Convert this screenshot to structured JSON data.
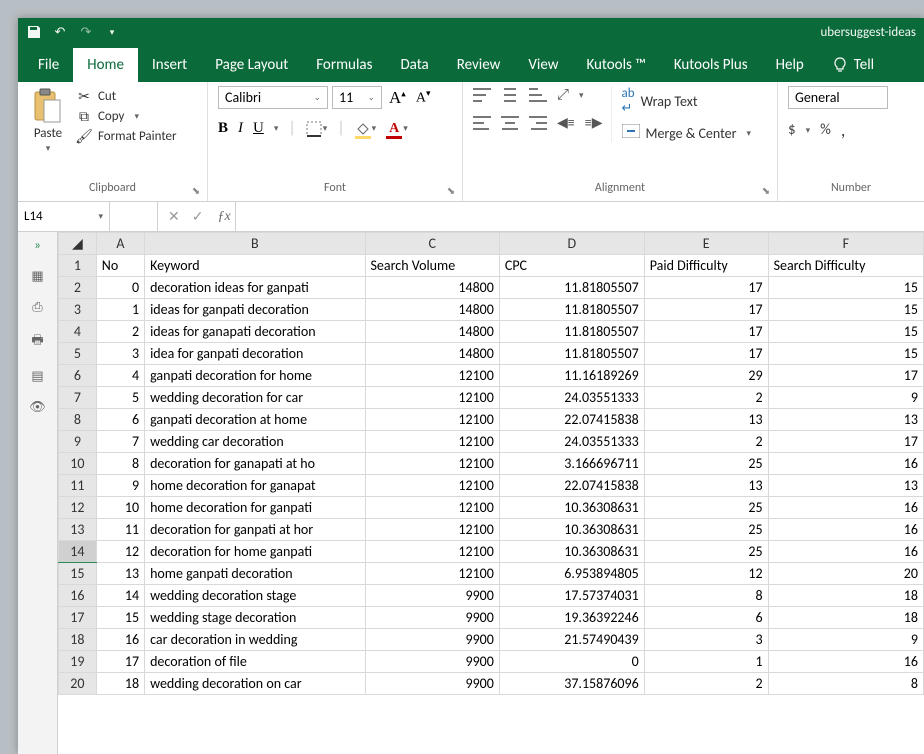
{
  "title": "ubersuggest-ideas",
  "tabs": [
    "File",
    "Home",
    "Insert",
    "Page Layout",
    "Formulas",
    "Data",
    "Review",
    "View",
    "Kutools ™",
    "Kutools Plus",
    "Help",
    "Tell"
  ],
  "activeTab": 1,
  "ribbon": {
    "clipboard": {
      "paste": "Paste",
      "cut": "Cut",
      "copy": "Copy",
      "fp": "Format Painter",
      "label": "Clipboard"
    },
    "font": {
      "name": "Calibri",
      "size": "11",
      "label": "Font"
    },
    "alignment": {
      "wrap": "Wrap Text",
      "merge": "Merge & Center",
      "label": "Alignment"
    },
    "number": {
      "format": "General",
      "label": "Number"
    }
  },
  "namebox": "L14",
  "columns": [
    "A",
    "B",
    "C",
    "D",
    "E",
    "F"
  ],
  "headerRow": {
    "A": "No",
    "B": "Keyword",
    "C": "Search Volume",
    "D": "CPC",
    "E": "Paid Difficulty",
    "F": "Search Difficulty"
  },
  "rows": [
    {
      "n": 2,
      "A": "0",
      "B": "decoration ideas for ganpati",
      "C": "14800",
      "D": "11.81805507",
      "E": "17",
      "F": "15"
    },
    {
      "n": 3,
      "A": "1",
      "B": "ideas for ganpati decoration",
      "C": "14800",
      "D": "11.81805507",
      "E": "17",
      "F": "15"
    },
    {
      "n": 4,
      "A": "2",
      "B": "ideas for ganapati decoration",
      "C": "14800",
      "D": "11.81805507",
      "E": "17",
      "F": "15"
    },
    {
      "n": 5,
      "A": "3",
      "B": "idea for ganpati decoration",
      "C": "14800",
      "D": "11.81805507",
      "E": "17",
      "F": "15"
    },
    {
      "n": 6,
      "A": "4",
      "B": "ganpati decoration for home",
      "C": "12100",
      "D": "11.16189269",
      "E": "29",
      "F": "17"
    },
    {
      "n": 7,
      "A": "5",
      "B": "wedding decoration for car",
      "C": "12100",
      "D": "24.03551333",
      "E": "2",
      "F": "9"
    },
    {
      "n": 8,
      "A": "6",
      "B": "ganpati decoration at home",
      "C": "12100",
      "D": "22.07415838",
      "E": "13",
      "F": "13"
    },
    {
      "n": 9,
      "A": "7",
      "B": "wedding car decoration",
      "C": "12100",
      "D": "24.03551333",
      "E": "2",
      "F": "17"
    },
    {
      "n": 10,
      "A": "8",
      "B": "decoration for ganapati at ho",
      "C": "12100",
      "D": "3.166696711",
      "E": "25",
      "F": "16"
    },
    {
      "n": 11,
      "A": "9",
      "B": "home decoration for ganapat",
      "C": "12100",
      "D": "22.07415838",
      "E": "13",
      "F": "13"
    },
    {
      "n": 12,
      "A": "10",
      "B": "home decoration for ganpati",
      "C": "12100",
      "D": "10.36308631",
      "E": "25",
      "F": "16"
    },
    {
      "n": 13,
      "A": "11",
      "B": "decoration for ganpati at hor",
      "C": "12100",
      "D": "10.36308631",
      "E": "25",
      "F": "16"
    },
    {
      "n": 14,
      "A": "12",
      "B": "decoration for home ganpati",
      "C": "12100",
      "D": "10.36308631",
      "E": "25",
      "F": "16",
      "sel": true
    },
    {
      "n": 15,
      "A": "13",
      "B": "home ganpati decoration",
      "C": "12100",
      "D": "6.953894805",
      "E": "12",
      "F": "20"
    },
    {
      "n": 16,
      "A": "14",
      "B": "wedding decoration stage",
      "C": "9900",
      "D": "17.57374031",
      "E": "8",
      "F": "18"
    },
    {
      "n": 17,
      "A": "15",
      "B": "wedding stage decoration",
      "C": "9900",
      "D": "19.36392246",
      "E": "6",
      "F": "18"
    },
    {
      "n": 18,
      "A": "16",
      "B": "car decoration in wedding",
      "C": "9900",
      "D": "21.57490439",
      "E": "3",
      "F": "9"
    },
    {
      "n": 19,
      "A": "17",
      "B": "decoration of file",
      "C": "9900",
      "D": "0",
      "E": "1",
      "F": "16"
    },
    {
      "n": 20,
      "A": "18",
      "B": "wedding decoration on car",
      "C": "9900",
      "D": "37.15876096",
      "E": "2",
      "F": "8"
    }
  ]
}
